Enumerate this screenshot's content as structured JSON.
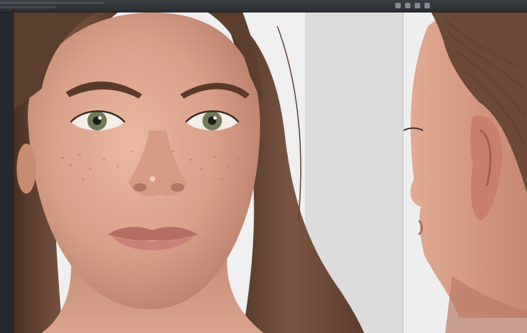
{
  "window": {
    "title": ""
  },
  "toolbar": {
    "icons": [
      "facebook-icon",
      "share-icon",
      "bookmark-icon",
      "settings-icon"
    ]
  },
  "canvas": {
    "panels": [
      {
        "name": "front-view",
        "subject": "portrait-render"
      },
      {
        "name": "side-view",
        "subject": "profile-render"
      }
    ]
  },
  "colors": {
    "chrome": "#2a2d31",
    "canvas_bg": "#f1f1f1",
    "skin": "#d8a58c",
    "hair": "#6b4a35"
  }
}
